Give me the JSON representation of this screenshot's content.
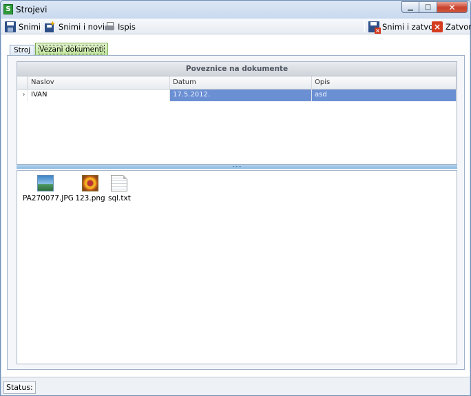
{
  "window": {
    "title": "Strojevi",
    "app_icon_letter": "S",
    "controls": [
      "minimize-icon",
      "maximize-icon",
      "close-icon"
    ]
  },
  "toolbar": {
    "save_label": "Snimi",
    "save_new_label": "Snimi i novi",
    "print_label": "Ispis",
    "save_close_label": "Snimi i zatvori",
    "close_label": "Zatvori"
  },
  "tabs": [
    {
      "label": "Stroj",
      "active": false
    },
    {
      "label": "Vezani dokumenti",
      "active": true
    }
  ],
  "grid": {
    "caption": "Poveznice na dokumente",
    "columns": [
      "Naslov",
      "Datum",
      "Opis"
    ],
    "rows": [
      {
        "naslov": "IVAN",
        "datum": "17.5.2012.",
        "opis": "asd",
        "current": true
      }
    ]
  },
  "files": [
    {
      "name": "PA270077.JPG",
      "icon": "image-jpg-icon"
    },
    {
      "name": "123.png",
      "icon": "image-png-icon"
    },
    {
      "name": "sql.txt",
      "icon": "text-file-icon"
    }
  ],
  "status": {
    "label": "Status:"
  },
  "colors": {
    "selection": "#6b8fd3",
    "active_tab": "#bfe69a",
    "close_button": "#c8402b"
  }
}
